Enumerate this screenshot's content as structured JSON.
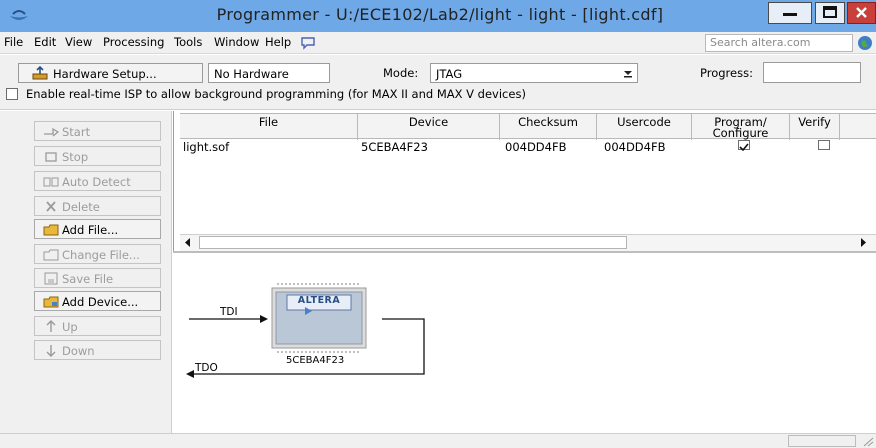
{
  "window": {
    "title": "Programmer - U:/ECE102/Lab2/light - light - [light.cdf]",
    "controls": {
      "minimize": "minimize-icon",
      "maximize": "maximize-icon",
      "close": "close-icon"
    }
  },
  "menu": {
    "items": [
      "File",
      "Edit",
      "View",
      "Processing",
      "Tools",
      "Window",
      "Help"
    ],
    "search_placeholder": "Search altera.com"
  },
  "toolbar": {
    "hardware_setup_label": "Hardware Setup...",
    "hardware_value": "No Hardware",
    "mode_label": "Mode:",
    "mode_value": "JTAG",
    "progress_label": "Progress:",
    "isp_label": "Enable real-time ISP to allow background programming (for MAX II and MAX V devices)",
    "isp_checked": false
  },
  "side_buttons": [
    {
      "label": "Start",
      "icon": "start-icon",
      "enabled": false
    },
    {
      "label": "Stop",
      "icon": "stop-icon",
      "enabled": false
    },
    {
      "label": "Auto Detect",
      "icon": "auto-detect-icon",
      "enabled": false
    },
    {
      "label": "Delete",
      "icon": "delete-icon",
      "enabled": false
    },
    {
      "label": "Add File...",
      "icon": "add-file-icon",
      "enabled": true
    },
    {
      "label": "Change File...",
      "icon": "change-file-icon",
      "enabled": false
    },
    {
      "label": "Save File",
      "icon": "save-file-icon",
      "enabled": false
    },
    {
      "label": "Add Device...",
      "icon": "add-device-icon",
      "enabled": true
    },
    {
      "label": "Up",
      "icon": "up-icon",
      "enabled": false
    },
    {
      "label": "Down",
      "icon": "down-icon",
      "enabled": false
    }
  ],
  "table": {
    "columns": [
      "File",
      "Device",
      "Checksum",
      "Usercode",
      "Program/ Configure",
      "Verify"
    ],
    "rows": [
      {
        "file": "light.sof",
        "device": "5CEBA4F23",
        "checksum": "004DD4FB",
        "usercode": "004DD4FB",
        "program": true,
        "verify": false
      }
    ]
  },
  "diagram": {
    "tdi_label": "TDI",
    "tdo_label": "TDO",
    "chip_logo": "ALTERA",
    "chip_device": "5CEBA4F23"
  },
  "colors": {
    "titlebar": "#6fa8e6",
    "close_button": "#c9403a"
  }
}
